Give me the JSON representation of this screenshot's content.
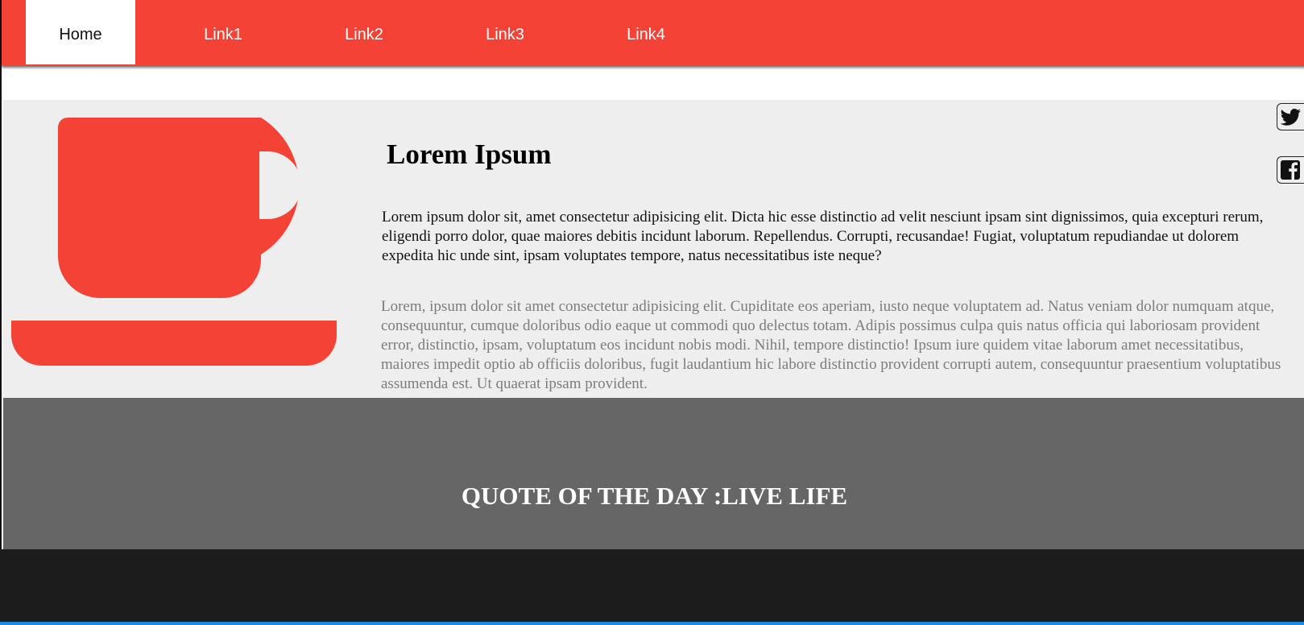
{
  "nav": {
    "items": [
      {
        "label": "Home",
        "active": true
      },
      {
        "label": "Link1",
        "active": false
      },
      {
        "label": "Link2",
        "active": false
      },
      {
        "label": "Link3",
        "active": false
      },
      {
        "label": "Link4",
        "active": false
      }
    ]
  },
  "content": {
    "title": "Lorem Ipsum",
    "paragraph1": "Lorem ipsum dolor sit, amet consectetur adipisicing elit. Dicta hic esse distinctio ad velit nesciunt ipsam sint dignissimos, quia excepturi rerum, eligendi porro dolor, quae maiores debitis incidunt laborum. Repellendus. Corrupti, recusandae! Fugiat, voluptatum repudiandae ut dolorem expedita hic unde sint, ipsam voluptates tempore, natus necessitatibus iste neque?",
    "paragraph2": "Lorem, ipsum dolor sit amet consectetur adipisicing elit. Cupiditate eos aperiam, iusto neque voluptatem ad. Natus veniam dolor numquam atque, consequuntur, cumque doloribus odio eaque ut commodi quo delectus totam. Adipis possimus culpa quis natus officia qui laboriosam provident error, distinctio, ipsam, voluptatum eos incidunt nobis modi. Nihil, tempore distinctio! Ipsum iure quidem vitae laborum amet necessitatibus, maiores impedit optio ab officiis doloribus, fugit laudantium hic labore distinctio provident corrupti autem, consequuntur praesentium voluptatibus assumenda est. Ut quaerat ipsam provident.",
    "image_icon": "coffee-cup-icon"
  },
  "social": [
    {
      "icon": "twitter-icon"
    },
    {
      "icon": "facebook-icon"
    }
  ],
  "quote": {
    "text": "QUOTE OF THE DAY :LIVE LIFE"
  },
  "colors": {
    "accent": "#f44336",
    "content_bg": "#efeeee",
    "quote_bg": "#666666",
    "footer_bg": "#1c1c1c",
    "muted_text": "#7c7c7c",
    "bottom_line": "#1e88e5"
  }
}
